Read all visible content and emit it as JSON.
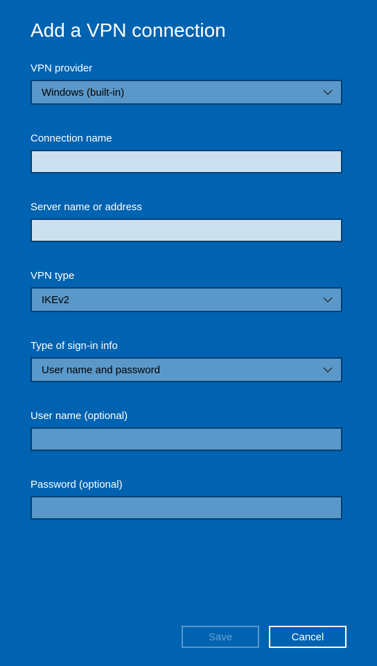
{
  "title": "Add a VPN connection",
  "fields": {
    "provider": {
      "label": "VPN provider",
      "value": "Windows (built-in)"
    },
    "connection_name": {
      "label": "Connection name",
      "value": ""
    },
    "server": {
      "label": "Server name or address",
      "value": ""
    },
    "vpn_type": {
      "label": "VPN type",
      "value": "IKEv2"
    },
    "signin_type": {
      "label": "Type of sign-in info",
      "value": "User name and password"
    },
    "username": {
      "label": "User name (optional)",
      "value": ""
    },
    "password": {
      "label": "Password (optional)",
      "value": ""
    }
  },
  "buttons": {
    "save": "Save",
    "cancel": "Cancel"
  }
}
